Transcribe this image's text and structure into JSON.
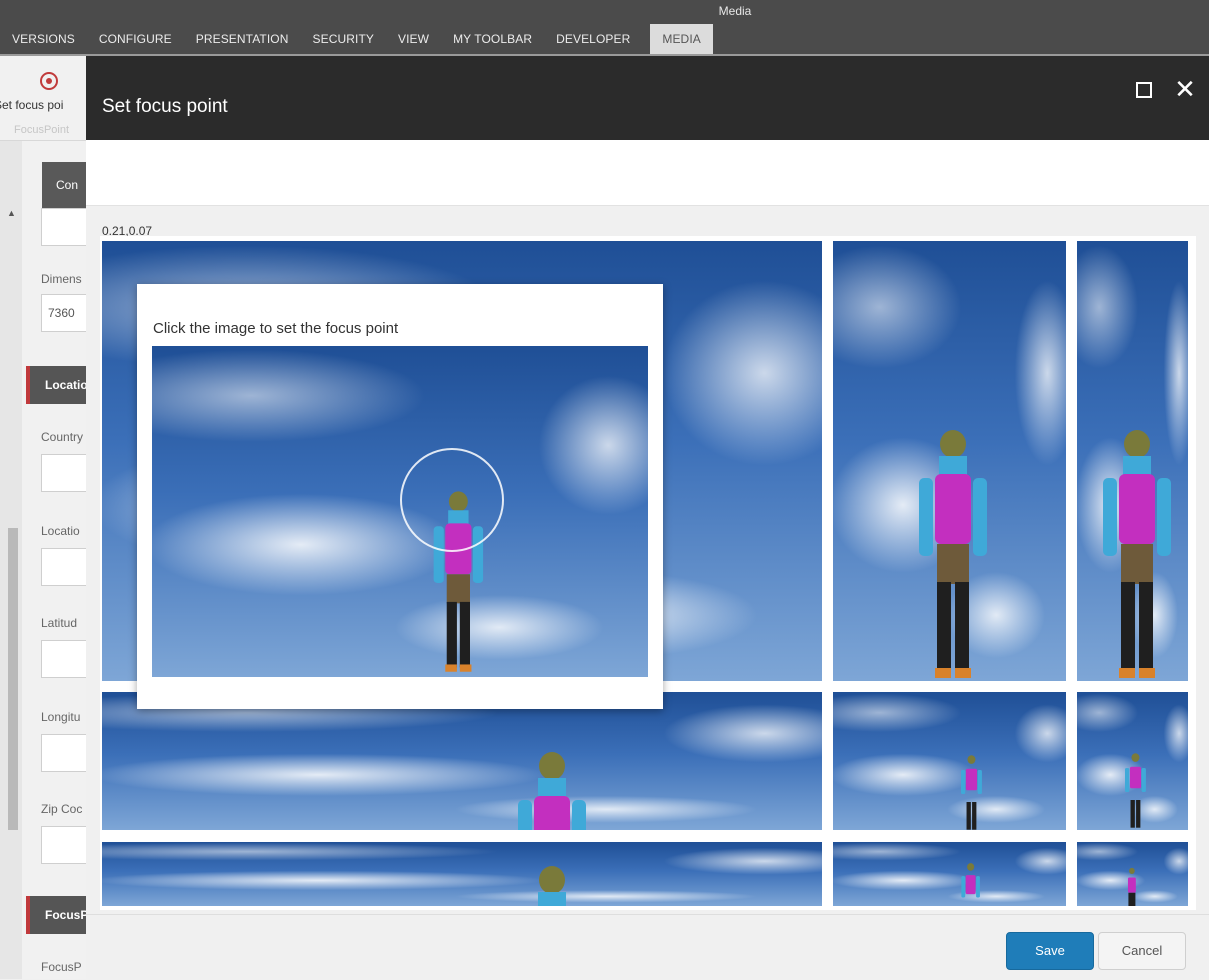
{
  "ribbon": {
    "context_label": "Media",
    "tabs": [
      "VERSIONS",
      "CONFIGURE",
      "PRESENTATION",
      "SECURITY",
      "VIEW",
      "MY TOOLBAR",
      "DEVELOPER",
      "MEDIA"
    ],
    "active_tab": "MEDIA"
  },
  "editor": {
    "command_title": "Set focus poi",
    "command_subtitle": "FocusPoint",
    "content_tab": "Con",
    "dimensions_label": "Dimens",
    "dimensions_value": "7360",
    "location_section": "Locatio",
    "fields": [
      "Country",
      "Locatio",
      "Latitud",
      "Longitu",
      "Zip Coc"
    ],
    "focus_section": "FocusP",
    "focus_field": "FocusP"
  },
  "dialog": {
    "title": "Set focus point",
    "coords": "0.21,0.07",
    "hint": "Click the image to set the focus point",
    "save_label": "Save",
    "cancel_label": "Cancel",
    "icons": {
      "maximize": "maximize-icon",
      "close": "close-icon",
      "focuspoint": "focus-point-icon"
    }
  },
  "colors": {
    "header": "#2b2b2b",
    "ribbon": "#4b4b4b",
    "save": "#1f7db9",
    "section_accent": "#c0393b"
  }
}
